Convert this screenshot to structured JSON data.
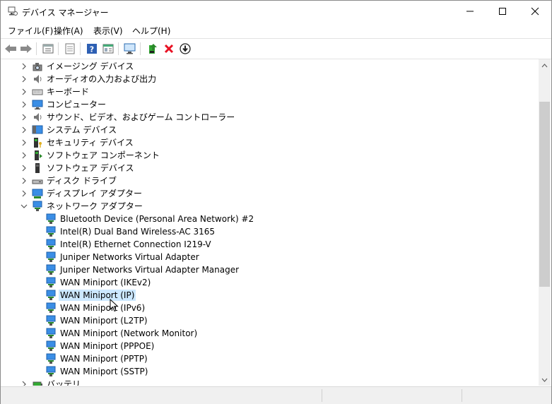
{
  "window": {
    "title": "デバイス マネージャー",
    "controls": {
      "minimize_icon": "minimize-icon",
      "maximize_icon": "maximize-icon",
      "close_icon": "close-icon"
    }
  },
  "menu": [
    {
      "label": "ファイル(F)"
    },
    {
      "label": "操作(A)"
    },
    {
      "label": "表示(V)"
    },
    {
      "label": "ヘルプ(H)"
    }
  ],
  "toolbar": {
    "icons": [
      "back-icon",
      "forward-icon",
      "properties-icon",
      "update-driver-list-icon",
      "help-icon",
      "view-icon",
      "scan-hardware-icon",
      "add-driver-icon",
      "uninstall-icon",
      "download-icon"
    ]
  },
  "tree": {
    "categories_top": [
      {
        "label": "イメージング デバイス",
        "icon": "imaging-device-icon"
      },
      {
        "label": "オーディオの入力および出力",
        "icon": "audio-io-icon"
      },
      {
        "label": "キーボード",
        "icon": "keyboard-icon"
      },
      {
        "label": "コンピューター",
        "icon": "computer-icon"
      },
      {
        "label": "サウンド、ビデオ、およびゲーム コントローラー",
        "icon": "sound-video-icon"
      },
      {
        "label": "システム デバイス",
        "icon": "system-device-icon"
      },
      {
        "label": "セキュリティ デバイス",
        "icon": "security-device-icon"
      },
      {
        "label": "ソフトウェア コンポーネント",
        "icon": "software-component-icon"
      },
      {
        "label": "ソフトウェア デバイス",
        "icon": "software-device-icon"
      },
      {
        "label": "ディスク ドライブ",
        "icon": "disk-drive-icon"
      },
      {
        "label": "ディスプレイ アダプター",
        "icon": "display-adapter-icon"
      }
    ],
    "network": {
      "label": "ネットワーク アダプター",
      "icon": "network-adapter-icon",
      "expanded": true,
      "children": [
        {
          "label": "Bluetooth Device (Personal Area Network) #2"
        },
        {
          "label": "Intel(R) Dual Band Wireless-AC 3165"
        },
        {
          "label": "Intel(R) Ethernet Connection I219-V"
        },
        {
          "label": "Juniper Networks Virtual Adapter"
        },
        {
          "label": "Juniper Networks Virtual Adapter Manager"
        },
        {
          "label": "WAN Miniport (IKEv2)"
        },
        {
          "label": "WAN Miniport (IP)",
          "selected": true
        },
        {
          "label": "WAN Miniport (IPv6)"
        },
        {
          "label": "WAN Miniport (L2TP)"
        },
        {
          "label": "WAN Miniport (Network Monitor)"
        },
        {
          "label": "WAN Miniport (PPPOE)"
        },
        {
          "label": "WAN Miniport (PPTP)"
        },
        {
          "label": "WAN Miniport (SSTP)"
        }
      ]
    },
    "categories_bottom": [
      {
        "label": "バッテリ",
        "icon": "battery-icon"
      }
    ]
  },
  "colors": {
    "selection": "#cce8ff",
    "accent": "#0078d7",
    "uninstall": "#e81123"
  }
}
